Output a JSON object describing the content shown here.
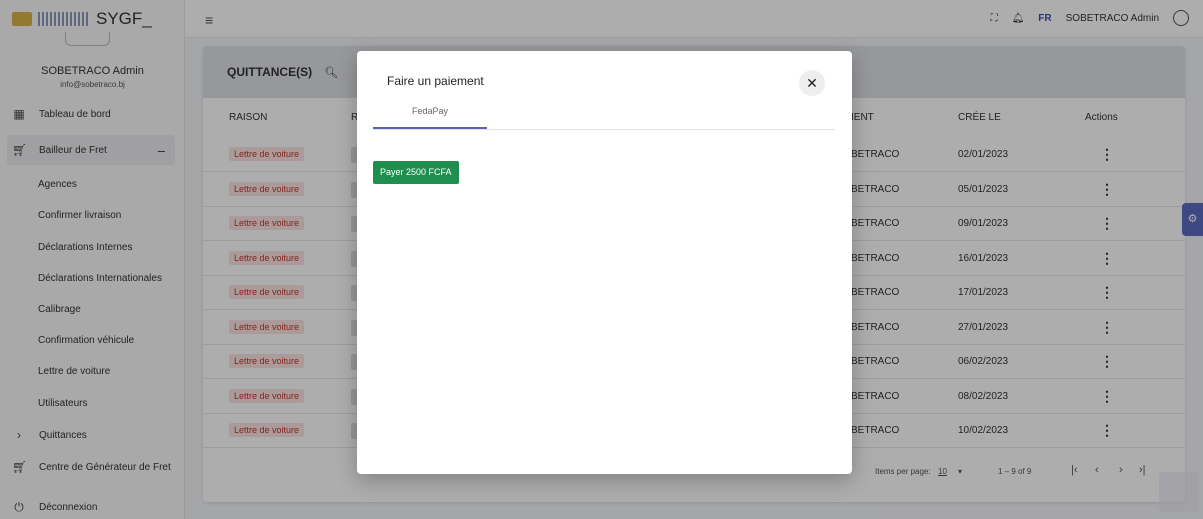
{
  "brand": {
    "app_name": "SYGF_"
  },
  "user": {
    "name": "SOBETRACO Admin",
    "email": "info@sobetraco.bj"
  },
  "sidebar": {
    "items": [
      {
        "label": "Tableau de bord",
        "icon": "dashboard-icon"
      },
      {
        "label": "Bailleur de Fret",
        "icon": "cart-icon",
        "toggle": "–"
      },
      {
        "label": "Quittances",
        "icon": "chevron-right-icon"
      },
      {
        "label": "Centre de Générateur de Fret",
        "icon": "cart-icon"
      },
      {
        "label": "Déconnexion",
        "icon": "power-icon"
      }
    ],
    "sub_items": [
      "Agences",
      "Confirmer livraison",
      "Déclarations Internes",
      "Déclarations Internationales",
      "Calibrage",
      "Confirmation véhicule",
      "Lettre de voiture",
      "Utilisateurs"
    ]
  },
  "header": {
    "lang": "FR",
    "user_label": "SOBETRACO Admin"
  },
  "table": {
    "title": "QUITTANCE(S)",
    "columns": {
      "raison": "RAISON",
      "r": "R",
      "client": "IENT",
      "created": "CRÉE LE",
      "actions": "Actions"
    },
    "rows": [
      {
        "raison": "Lettre de voiture",
        "client": "BETRACO",
        "date": "02/01/2023"
      },
      {
        "raison": "Lettre de voiture",
        "client": "BETRACO",
        "date": "05/01/2023"
      },
      {
        "raison": "Lettre de voiture",
        "client": "BETRACO",
        "date": "09/01/2023"
      },
      {
        "raison": "Lettre de voiture",
        "client": "BETRACO",
        "date": "16/01/2023"
      },
      {
        "raison": "Lettre de voiture",
        "client": "BETRACO",
        "date": "17/01/2023"
      },
      {
        "raison": "Lettre de voiture",
        "client": "BETRACO",
        "date": "27/01/2023"
      },
      {
        "raison": "Lettre de voiture",
        "client": "BETRACO",
        "date": "06/02/2023"
      },
      {
        "raison": "Lettre de voiture",
        "client": "BETRACO",
        "date": "08/02/2023"
      },
      {
        "raison": "Lettre de voiture",
        "client": "BETRACO",
        "date": "10/02/2023"
      }
    ],
    "kebab": "⋮",
    "pager": {
      "items_label": "Items per page:",
      "per_page": "10",
      "range": "1 – 9 of 9"
    }
  },
  "dialog": {
    "title": "Faire un paiement",
    "close": "✕",
    "tab": "FedaPay",
    "pay_button": "Payer 2500 FCFA"
  }
}
